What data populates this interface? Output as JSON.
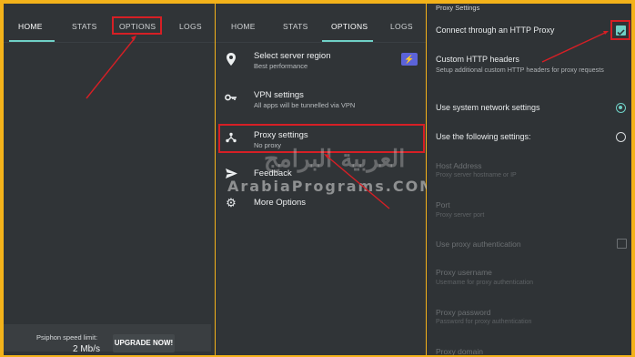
{
  "left_panel": {
    "tabs": [
      {
        "label": "HOME",
        "active": true
      },
      {
        "label": "STATS",
        "active": false
      },
      {
        "label": "OPTIONS",
        "active": false
      },
      {
        "label": "LOGS",
        "active": false
      }
    ],
    "speed_limit_label": "Psiphon speed limit:",
    "speed_limit_value": "2 Mb/s",
    "upgrade_button": "UPGRADE NOW!"
  },
  "middle_panel": {
    "tabs": [
      {
        "label": "HOME",
        "active": false
      },
      {
        "label": "STATS",
        "active": false
      },
      {
        "label": "OPTIONS",
        "active": true
      },
      {
        "label": "LOGS",
        "active": false
      }
    ],
    "menu_items": [
      {
        "title": "Select server region",
        "subtitle": "Best performance",
        "icon": "location-pin-icon"
      },
      {
        "title": "VPN settings",
        "subtitle": "All apps will be tunnelled via VPN",
        "icon": "key-icon"
      },
      {
        "title": "Proxy settings",
        "subtitle": "No proxy",
        "icon": "share-network-icon"
      },
      {
        "title": "Feedback",
        "subtitle": "",
        "icon": "send-icon"
      },
      {
        "title": "More Options",
        "subtitle": "",
        "icon": "gear-icon"
      }
    ],
    "watermark_arabic": "العربية البرامج",
    "watermark_latin": "ArabiaPrograms.COM"
  },
  "right_panel": {
    "section_heading": "Proxy Settings",
    "connect_http_proxy": {
      "label": "Connect through an HTTP Proxy",
      "checked": true
    },
    "custom_headers": {
      "title": "Custom HTTP headers",
      "subtitle": "Setup additional custom HTTP headers for proxy requests"
    },
    "use_system": {
      "label": "Use system network settings",
      "selected": true
    },
    "use_following": {
      "label": "Use the following settings:",
      "selected": false
    },
    "host_address": {
      "title": "Host Address",
      "subtitle": "Proxy server hostname or IP"
    },
    "port": {
      "title": "Port",
      "subtitle": "Proxy server port"
    },
    "use_auth": {
      "label": "Use proxy authentication",
      "checked": false
    },
    "proxy_username": {
      "title": "Proxy username",
      "subtitle": "Username for proxy authentication"
    },
    "proxy_password": {
      "title": "Proxy password",
      "subtitle": "Password for proxy authentication"
    },
    "proxy_domain": {
      "title": "Proxy domain"
    }
  },
  "colors": {
    "frame": "#f3b21a",
    "panel_bg": "#303437",
    "accent_teal": "#6fd0c6",
    "annotation_red": "#d61f25",
    "region_toggle": "#5b63d9"
  }
}
